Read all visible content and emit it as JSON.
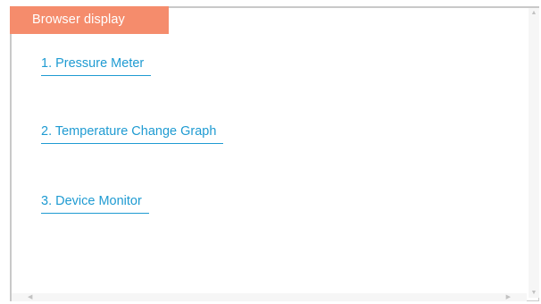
{
  "window": {
    "title": "Browser display"
  },
  "links": [
    {
      "label": "1. Pressure Meter"
    },
    {
      "label": "2. Temperature Change Graph"
    },
    {
      "label": "3. Device Monitor"
    }
  ],
  "scrollbars": {
    "up_icon": "triangle-up",
    "down_icon": "triangle-down",
    "left_icon": "triangle-left",
    "right_icon": "triangle-right"
  },
  "colors": {
    "tab_background": "#f58c6c",
    "link": "#1f9bd2",
    "frame_border": "#c9c9c9"
  }
}
